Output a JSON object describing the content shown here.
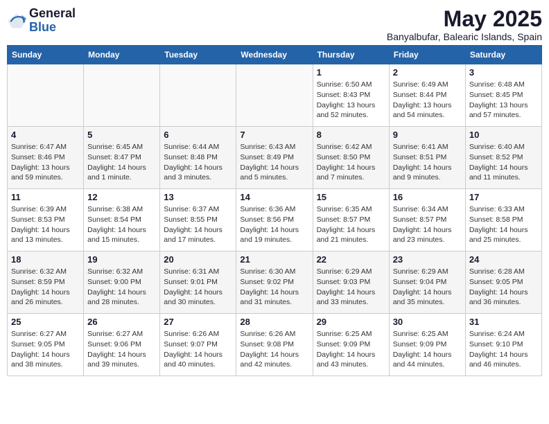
{
  "header": {
    "logo_general": "General",
    "logo_blue": "Blue",
    "month_title": "May 2025",
    "subtitle": "Banyalbufar, Balearic Islands, Spain"
  },
  "weekdays": [
    "Sunday",
    "Monday",
    "Tuesday",
    "Wednesday",
    "Thursday",
    "Friday",
    "Saturday"
  ],
  "weeks": [
    [
      {
        "day": "",
        "info": ""
      },
      {
        "day": "",
        "info": ""
      },
      {
        "day": "",
        "info": ""
      },
      {
        "day": "",
        "info": ""
      },
      {
        "day": "1",
        "info": "Sunrise: 6:50 AM\nSunset: 8:43 PM\nDaylight: 13 hours\nand 52 minutes."
      },
      {
        "day": "2",
        "info": "Sunrise: 6:49 AM\nSunset: 8:44 PM\nDaylight: 13 hours\nand 54 minutes."
      },
      {
        "day": "3",
        "info": "Sunrise: 6:48 AM\nSunset: 8:45 PM\nDaylight: 13 hours\nand 57 minutes."
      }
    ],
    [
      {
        "day": "4",
        "info": "Sunrise: 6:47 AM\nSunset: 8:46 PM\nDaylight: 13 hours\nand 59 minutes."
      },
      {
        "day": "5",
        "info": "Sunrise: 6:45 AM\nSunset: 8:47 PM\nDaylight: 14 hours\nand 1 minute."
      },
      {
        "day": "6",
        "info": "Sunrise: 6:44 AM\nSunset: 8:48 PM\nDaylight: 14 hours\nand 3 minutes."
      },
      {
        "day": "7",
        "info": "Sunrise: 6:43 AM\nSunset: 8:49 PM\nDaylight: 14 hours\nand 5 minutes."
      },
      {
        "day": "8",
        "info": "Sunrise: 6:42 AM\nSunset: 8:50 PM\nDaylight: 14 hours\nand 7 minutes."
      },
      {
        "day": "9",
        "info": "Sunrise: 6:41 AM\nSunset: 8:51 PM\nDaylight: 14 hours\nand 9 minutes."
      },
      {
        "day": "10",
        "info": "Sunrise: 6:40 AM\nSunset: 8:52 PM\nDaylight: 14 hours\nand 11 minutes."
      }
    ],
    [
      {
        "day": "11",
        "info": "Sunrise: 6:39 AM\nSunset: 8:53 PM\nDaylight: 14 hours\nand 13 minutes."
      },
      {
        "day": "12",
        "info": "Sunrise: 6:38 AM\nSunset: 8:54 PM\nDaylight: 14 hours\nand 15 minutes."
      },
      {
        "day": "13",
        "info": "Sunrise: 6:37 AM\nSunset: 8:55 PM\nDaylight: 14 hours\nand 17 minutes."
      },
      {
        "day": "14",
        "info": "Sunrise: 6:36 AM\nSunset: 8:56 PM\nDaylight: 14 hours\nand 19 minutes."
      },
      {
        "day": "15",
        "info": "Sunrise: 6:35 AM\nSunset: 8:57 PM\nDaylight: 14 hours\nand 21 minutes."
      },
      {
        "day": "16",
        "info": "Sunrise: 6:34 AM\nSunset: 8:57 PM\nDaylight: 14 hours\nand 23 minutes."
      },
      {
        "day": "17",
        "info": "Sunrise: 6:33 AM\nSunset: 8:58 PM\nDaylight: 14 hours\nand 25 minutes."
      }
    ],
    [
      {
        "day": "18",
        "info": "Sunrise: 6:32 AM\nSunset: 8:59 PM\nDaylight: 14 hours\nand 26 minutes."
      },
      {
        "day": "19",
        "info": "Sunrise: 6:32 AM\nSunset: 9:00 PM\nDaylight: 14 hours\nand 28 minutes."
      },
      {
        "day": "20",
        "info": "Sunrise: 6:31 AM\nSunset: 9:01 PM\nDaylight: 14 hours\nand 30 minutes."
      },
      {
        "day": "21",
        "info": "Sunrise: 6:30 AM\nSunset: 9:02 PM\nDaylight: 14 hours\nand 31 minutes."
      },
      {
        "day": "22",
        "info": "Sunrise: 6:29 AM\nSunset: 9:03 PM\nDaylight: 14 hours\nand 33 minutes."
      },
      {
        "day": "23",
        "info": "Sunrise: 6:29 AM\nSunset: 9:04 PM\nDaylight: 14 hours\nand 35 minutes."
      },
      {
        "day": "24",
        "info": "Sunrise: 6:28 AM\nSunset: 9:05 PM\nDaylight: 14 hours\nand 36 minutes."
      }
    ],
    [
      {
        "day": "25",
        "info": "Sunrise: 6:27 AM\nSunset: 9:05 PM\nDaylight: 14 hours\nand 38 minutes."
      },
      {
        "day": "26",
        "info": "Sunrise: 6:27 AM\nSunset: 9:06 PM\nDaylight: 14 hours\nand 39 minutes."
      },
      {
        "day": "27",
        "info": "Sunrise: 6:26 AM\nSunset: 9:07 PM\nDaylight: 14 hours\nand 40 minutes."
      },
      {
        "day": "28",
        "info": "Sunrise: 6:26 AM\nSunset: 9:08 PM\nDaylight: 14 hours\nand 42 minutes."
      },
      {
        "day": "29",
        "info": "Sunrise: 6:25 AM\nSunset: 9:09 PM\nDaylight: 14 hours\nand 43 minutes."
      },
      {
        "day": "30",
        "info": "Sunrise: 6:25 AM\nSunset: 9:09 PM\nDaylight: 14 hours\nand 44 minutes."
      },
      {
        "day": "31",
        "info": "Sunrise: 6:24 AM\nSunset: 9:10 PM\nDaylight: 14 hours\nand 46 minutes."
      }
    ]
  ]
}
